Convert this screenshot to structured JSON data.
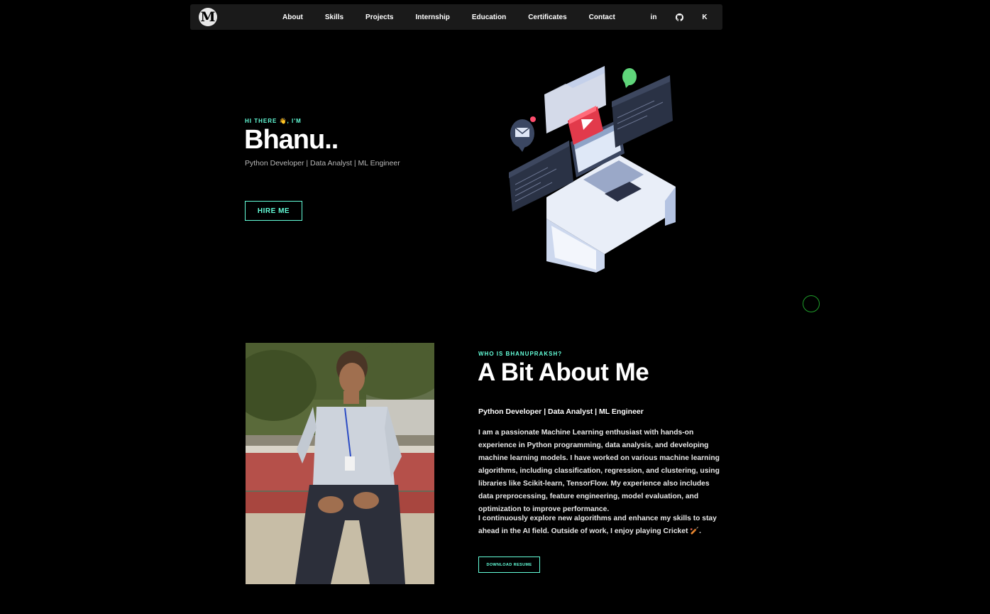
{
  "nav": {
    "logo": "M",
    "links": [
      "About",
      "Skills",
      "Projects",
      "Internship",
      "Education",
      "Certificates",
      "Contact"
    ],
    "socials": [
      {
        "name": "linkedin-icon",
        "glyph": "in"
      },
      {
        "name": "github-icon",
        "glyph": ""
      },
      {
        "name": "kaggle-icon",
        "glyph": "K"
      }
    ]
  },
  "hero": {
    "eyebrow": "HI THERE 👋, I'M",
    "name": "Bhanu..",
    "role": "Python Developer | Data Analyst | ML Engineer",
    "hire_label": "HIRE ME"
  },
  "about": {
    "eyebrow": "WHO IS BHANUPRAKSH?",
    "title": "A Bit About Me",
    "role": "Python Developer | Data Analyst | ML Engineer",
    "p1": "I am a passionate Machine Learning enthusiast with hands-on experience in Python programming, data analysis, and developing machine learning models. I have worked on various machine learning algorithms, including classification, regression, and clustering, using libraries like Scikit-learn, TensorFlow. My experience also includes data preprocessing, feature engineering, model evaluation, and optimization to improve performance.",
    "p2": "I continuously explore new algorithms and enhance my skills to stay ahead in the AI field. Outside of work, I enjoy playing Cricket 🏏.",
    "resume_label": "DOWNLOAD RESUME"
  },
  "colors": {
    "accent": "#64ffda",
    "background": "#000000",
    "navbar": "#1a1a1a"
  }
}
